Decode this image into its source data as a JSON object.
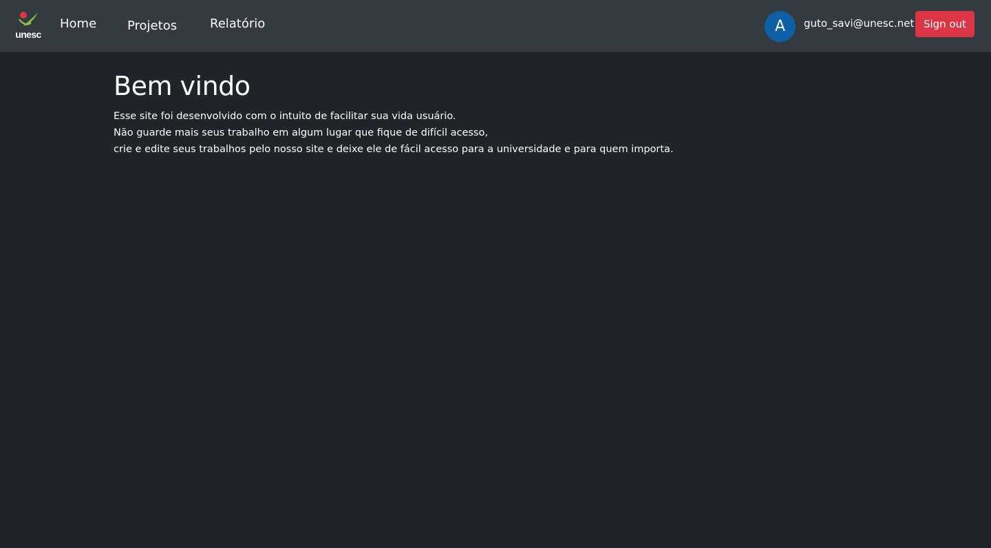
{
  "brand": {
    "logo_text": "unesc",
    "colors": {
      "dot": "#e4353f",
      "leaf": "#8cc63f",
      "leaf_dark": "#3f9a38"
    }
  },
  "nav": {
    "items": [
      {
        "label": "Home"
      },
      {
        "label": "Projetos"
      },
      {
        "label": "Relatório"
      }
    ]
  },
  "user": {
    "avatar_initial": "A",
    "email": "guto_savi@unesc.net",
    "signout_label": "Sign out"
  },
  "main": {
    "title": "Bem vindo",
    "paragraph_lines": [
      "Esse site foi desenvolvido com o intuito de facilitar sua vida usuário.",
      "Não guarde mais seus trabalho em algum lugar que fique de difícil acesso,",
      "crie e edite seus trabalhos pelo nosso site e deixe ele de fácil acesso para a universidade e para quem importa."
    ]
  },
  "theme": {
    "background": "#212529",
    "navbar": "#343a40",
    "signout_button": "#dc3545",
    "avatar": "#0d5fa6"
  }
}
